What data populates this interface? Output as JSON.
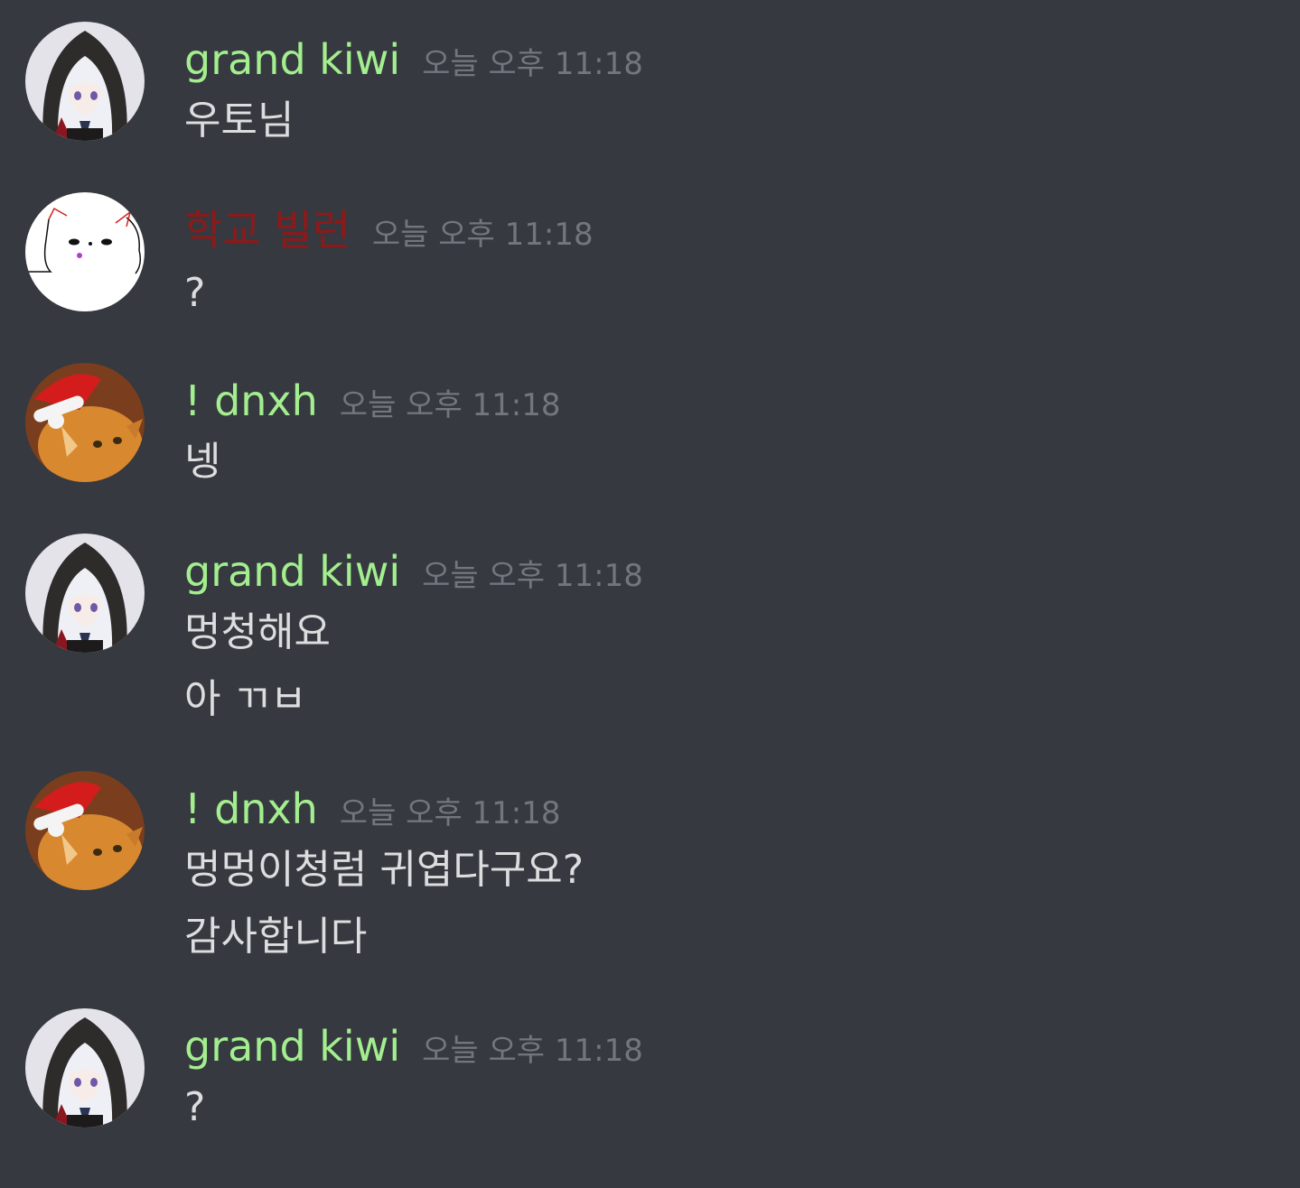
{
  "colors": {
    "background": "#36393f",
    "username_green": "#a3ee8e",
    "username_red": "#8b1a1a",
    "timestamp": "#72767d",
    "text": "#dcddde"
  },
  "messages": [
    {
      "author": "grand kiwi",
      "avatar": "anime-girl-hood-avatar",
      "timestamp": "오늘 오후 11:18",
      "lines": [
        "우토님"
      ]
    },
    {
      "author": "학교 빌런",
      "avatar": "white-cat-drawing-avatar",
      "timestamp": "오늘 오후 11:18",
      "lines": [
        "?"
      ]
    },
    {
      "author": "! dnxh",
      "avatar": "santa-hat-cat-avatar",
      "timestamp": "오늘 오후 11:18",
      "lines": [
        "넹"
      ]
    },
    {
      "author": "grand kiwi",
      "avatar": "anime-girl-hood-avatar",
      "timestamp": "오늘 오후 11:18",
      "lines": [
        "멍청해요",
        "아 ㄲㅂ"
      ]
    },
    {
      "author": "! dnxh",
      "avatar": "santa-hat-cat-avatar",
      "timestamp": "오늘 오후 11:18",
      "lines": [
        "멍멍이청럼 귀엽다구요?",
        "감사합니다"
      ]
    },
    {
      "author": "grand kiwi",
      "avatar": "anime-girl-hood-avatar",
      "timestamp": "오늘 오후 11:18",
      "lines": [
        "?"
      ]
    }
  ]
}
